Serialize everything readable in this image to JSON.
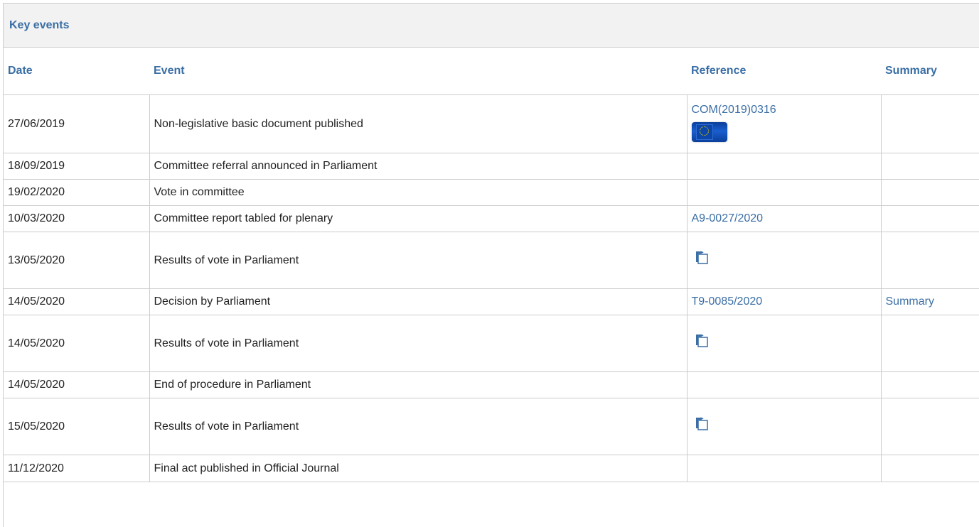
{
  "section": {
    "title": "Key events"
  },
  "columns": {
    "date": "Date",
    "event": "Event",
    "reference": "Reference",
    "summary": "Summary"
  },
  "rows": [
    {
      "date": "27/06/2019",
      "event": "Non-legislative basic document published",
      "reference": "COM(2019)0316",
      "reference_icon": "eu-flag-icon",
      "summary": ""
    },
    {
      "date": "18/09/2019",
      "event": "Committee referral announced in Parliament",
      "reference": "",
      "summary": ""
    },
    {
      "date": "19/02/2020",
      "event": "Vote in committee",
      "reference": "",
      "summary": ""
    },
    {
      "date": "10/03/2020",
      "event": "Committee report tabled for plenary",
      "reference": "A9-0027/2020",
      "summary": ""
    },
    {
      "date": "13/05/2020",
      "event": "Results of vote in Parliament",
      "reference": "",
      "reference_icon": "vote-results-icon",
      "summary": ""
    },
    {
      "date": "14/05/2020",
      "event": "Decision by Parliament",
      "reference": "T9-0085/2020",
      "summary": "Summary"
    },
    {
      "date": "14/05/2020",
      "event": "Results of vote in Parliament",
      "reference": "",
      "reference_icon": "vote-results-icon",
      "summary": ""
    },
    {
      "date": "14/05/2020",
      "event": "End of procedure in Parliament",
      "reference": "",
      "summary": ""
    },
    {
      "date": "15/05/2020",
      "event": "Results of vote in Parliament",
      "reference": "",
      "reference_icon": "vote-results-icon",
      "summary": ""
    },
    {
      "date": "11/12/2020",
      "event": "Final act published in Official Journal",
      "reference": "",
      "summary": ""
    }
  ],
  "colors": {
    "link": "#3a6ea5",
    "header_bg": "#f2f2f2",
    "border": "#cccccc"
  }
}
